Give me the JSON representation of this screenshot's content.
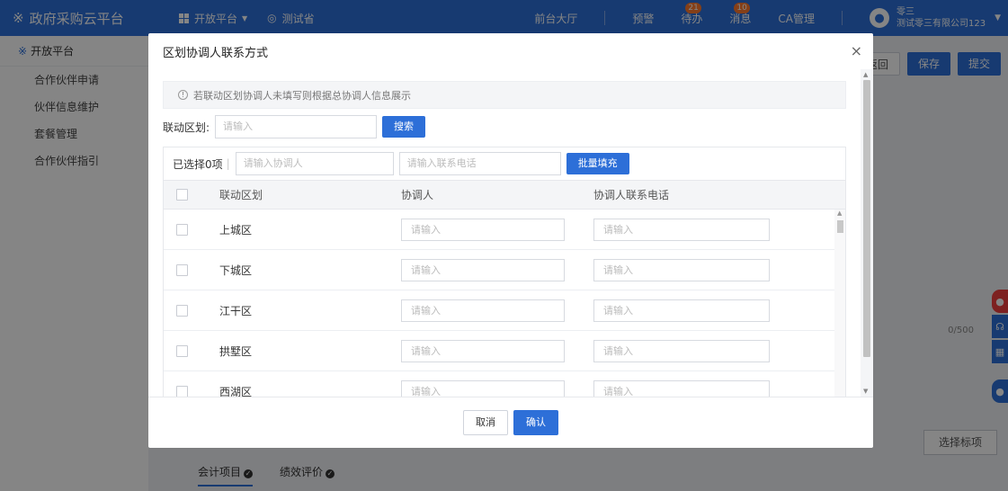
{
  "app": {
    "brand": "政府采购云平台",
    "platform_menu": "开放平台",
    "region": "测试省",
    "nav": {
      "front_hall": "前台大厅",
      "warning": "预警",
      "todo": "待办",
      "todo_count": "21",
      "messages": "消息",
      "messages_count": "10",
      "ca_manage": "CA管理"
    },
    "user": {
      "name": "零三",
      "company": "测试零三有限公司123"
    }
  },
  "sidebar": {
    "header": "开放平台",
    "items": [
      {
        "label": "合作伙伴申请"
      },
      {
        "label": "伙伴信息维护"
      },
      {
        "label": "套餐管理"
      },
      {
        "label": "合作伙伴指引"
      }
    ]
  },
  "page": {
    "back_label": "返回",
    "save_label": "保存",
    "submit_label": "提交",
    "counter": "0/500",
    "select_tag_label": "选择标项",
    "tabs": [
      {
        "label": "会计项目"
      },
      {
        "label": "绩效评价"
      }
    ]
  },
  "modal": {
    "title": "区划协调人联系方式",
    "close_icon": "×",
    "notice": "若联动区划协调人未填写则根据总协调人信息展示",
    "search": {
      "label": "联动区划:",
      "placeholder": "请输入",
      "button": "搜索"
    },
    "batch": {
      "selected_text": "已选择0项",
      "coordinator_placeholder": "请输入协调人",
      "phone_placeholder": "请输入联系电话",
      "button": "批量填充"
    },
    "table": {
      "columns": {
        "area": "联动区划",
        "coordinator": "协调人",
        "phone": "协调人联系电话"
      },
      "cell_placeholder": "请输入",
      "rows": [
        {
          "area": "上城区"
        },
        {
          "area": "下城区"
        },
        {
          "area": "江干区"
        },
        {
          "area": "拱墅区"
        },
        {
          "area": "西湖区"
        }
      ]
    },
    "footer": {
      "cancel": "取消",
      "confirm": "确认"
    }
  }
}
